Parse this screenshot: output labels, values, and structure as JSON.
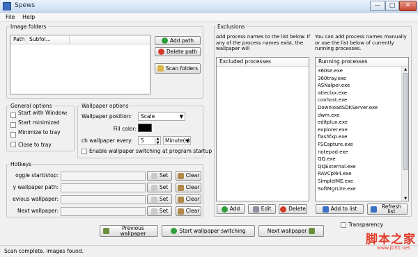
{
  "window": {
    "title": "Spews",
    "minimize": "—",
    "maximize": "□",
    "close": "✕"
  },
  "menu": {
    "file": "File",
    "help": "Help"
  },
  "image_folders": {
    "group_label": "Image folders",
    "columns": [
      "Path",
      "Subfol..."
    ],
    "add_path": "Add path",
    "delete_path": "Delete path",
    "scan_folders": "Scan folders"
  },
  "general_options": {
    "group_label": "General options",
    "start_with_windows": "Start with Windows",
    "start_minimized": "Start minimized",
    "minimize_to_tray": "Minimize to tray",
    "close_to_tray": "Close to tray"
  },
  "wallpaper_options": {
    "group_label": "Wallpaper options",
    "position_label": "Wallpaper position:",
    "position_value": "Scale",
    "fill_color_label": "Fill color:",
    "fill_color": "#000000",
    "change_every_label": "ch wallpaper every:",
    "change_every_value": "5",
    "change_unit": "Minute(s)",
    "enable_switching": "Enable wallpaper switching at program startup"
  },
  "hotkeys": {
    "group_label": "Hotkeys",
    "rows": [
      {
        "label": "oggle start/stop:",
        "set": "Set",
        "clear": "Clear"
      },
      {
        "label": "y wallpaper path:",
        "set": "Set",
        "clear": "Clear"
      },
      {
        "label": "evious wallpaper:",
        "set": "Set",
        "clear": "Clear"
      },
      {
        "label": "Next wallpaper:",
        "set": "Set",
        "clear": "Clear"
      }
    ]
  },
  "exclusions": {
    "group_label": "Exclusions",
    "hint_left": "Add process names to the list below.  If any of the process names exist, the wallpaper will",
    "hint_right": "You can add process names manually or use the list below of currently running processes.",
    "excluded_header": "Excluded processes",
    "running_header": "Running processes",
    "running": [
      "360se.exe",
      "360tray.exe",
      "ASNalper.exe",
      "atieclxx.exe",
      "conhost.exe",
      "DownloadSDKServer.exe",
      "dwm.exe",
      "editplux.exe",
      "explorer.exe",
      "flashfxp.exe",
      "FSCapture.exe",
      "notepad.exe",
      "QQ.exe",
      "QQExternal.exe",
      "RAVCpl64.exe",
      "SimpleIME.exe",
      "SoftMgrLite.exe"
    ],
    "add": "Add",
    "edit": "Edit",
    "delete": "Delete",
    "add_to_list": "Add to list",
    "refresh_list": "Refresh list"
  },
  "bottom": {
    "previous": "Previous wallpaper",
    "start_switching": "Start wallpaper switching",
    "next": "Next wallpaper",
    "transparency": "Transparency"
  },
  "status": {
    "text": "Scan complete.   images found."
  },
  "watermark": {
    "cn": "脚本之家",
    "url": "www.jb51.net"
  }
}
